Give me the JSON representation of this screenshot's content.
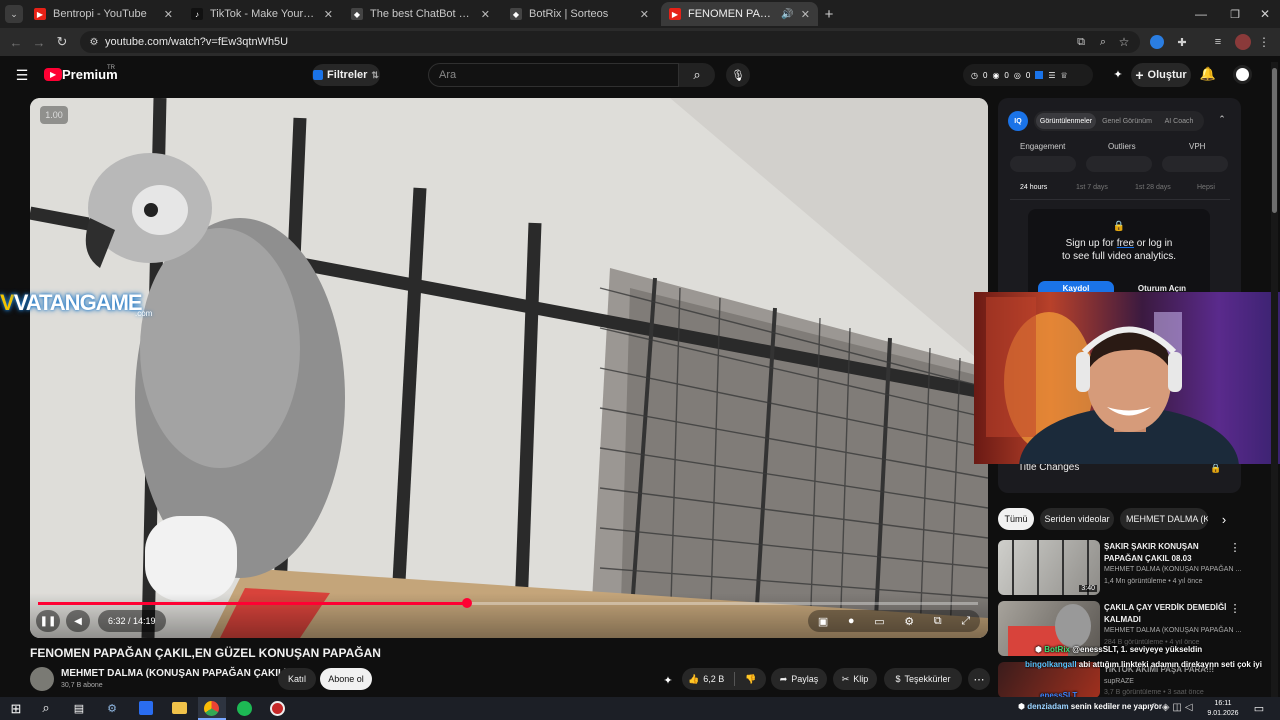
{
  "tabs": [
    {
      "title": "Bentropi - YouTube",
      "fav_color": "#e62117"
    },
    {
      "title": "TikTok - Make Your Day",
      "fav_color": "#111111"
    },
    {
      "title": "The best ChatBot and Widgets",
      "fav_color": "#111111"
    },
    {
      "title": "BotRix | Sorteos",
      "fav_color": "#111111"
    },
    {
      "title": "FENOMEN PAPAĞAN ÇAKIL",
      "fav_color": "#e62117"
    }
  ],
  "url": "youtube.com/watch?v=fEw3qtnWh5U",
  "yt": {
    "logo": "Premium",
    "logo_sup": "TR",
    "filter_label": "Filtreler",
    "search_placeholder": "Ara",
    "counters": [
      "0",
      "0",
      "0"
    ],
    "create_label": "Oluştur"
  },
  "player": {
    "speed": "1.00",
    "time": "6:32 / 14:19",
    "progress": 0.456
  },
  "watermark": {
    "brand": "VATANGAME",
    "sub": ".com"
  },
  "video": {
    "title": "FENOMEN PAPAĞAN ÇAKIL,EN GÜZEL KONUŞAN PAPAĞAN",
    "channel": "MEHMET DALMA (KONUŞAN PAPAĞAN ÇAKIL)",
    "subs": "30,7 B abone",
    "join": "Katıl",
    "subscribe": "Abone ol",
    "likes": "6,2 B",
    "share": "Paylaş",
    "clip": "Klip",
    "thanks": "Teşekkürler"
  },
  "iq": {
    "tabs": [
      "Görüntülenmeler",
      "Genel Görünüm",
      "AI Coach"
    ],
    "metrics": [
      "Engagement",
      "Outliers",
      "VPH"
    ],
    "ranges": [
      "24 hours",
      "1st 7 days",
      "1st 28 days",
      "Hepsi"
    ],
    "signup_line1a": "Sign up for ",
    "signup_free": "free",
    "signup_line1b": " or log in",
    "signup_line2": "to see full video analytics.",
    "register": "Kaydol",
    "login": "Oturum Açın",
    "title_changes": "Title Changes"
  },
  "chips": [
    "Tümü",
    "Seriden videolar",
    "MEHMET DALMA (KO"
  ],
  "recs": [
    {
      "title1": "ŞAKIR ŞAKIR KONUŞAN",
      "title2": "PAPAĞAN ÇAKIL 08.03",
      "channel": "MEHMET DALMA (KONUŞAN PAPAĞAN ...",
      "meta": "1,4 Mn görüntüleme • 4 yıl önce",
      "duration": "3:40"
    },
    {
      "title1": "ÇAKILA ÇAY VERDİK DEMEDİĞİ",
      "title2": "KALMADI",
      "channel": "MEHMET DALMA (KONUŞAN PAPAĞAN ...",
      "meta": "284 B görüntüleme • 4 yıl önce",
      "duration": ""
    },
    {
      "title1": "TIKTOK AKIMI PAŞA PARA!!!",
      "title2": "",
      "channel": "supRAZE",
      "meta": "3,7 B görüntüleme • 3 saat önce",
      "duration": ""
    }
  ],
  "chat": [
    {
      "user": "BotRix",
      "text": "@enessSLT, 1. seviyeye yükseldin",
      "color": "#3ee07a"
    },
    {
      "user": "bingolkangall",
      "text": "abi attığım linkteki adamın direkaynn seti çok iyi",
      "color": "#58c4ff"
    },
    {
      "user": "enessSLT",
      "text": "",
      "color": "#3a86ff"
    },
    {
      "user": "denziadam",
      "text": "senin kediler ne yapıyor",
      "color": "#9ad3ff"
    }
  ],
  "webcam_label": "Title Changes",
  "taskbar": {
    "time": "16:11",
    "date": "9.01.2026"
  },
  "colors": {
    "accent_red": "#ff0033",
    "iq_blue": "#1a73e8"
  }
}
